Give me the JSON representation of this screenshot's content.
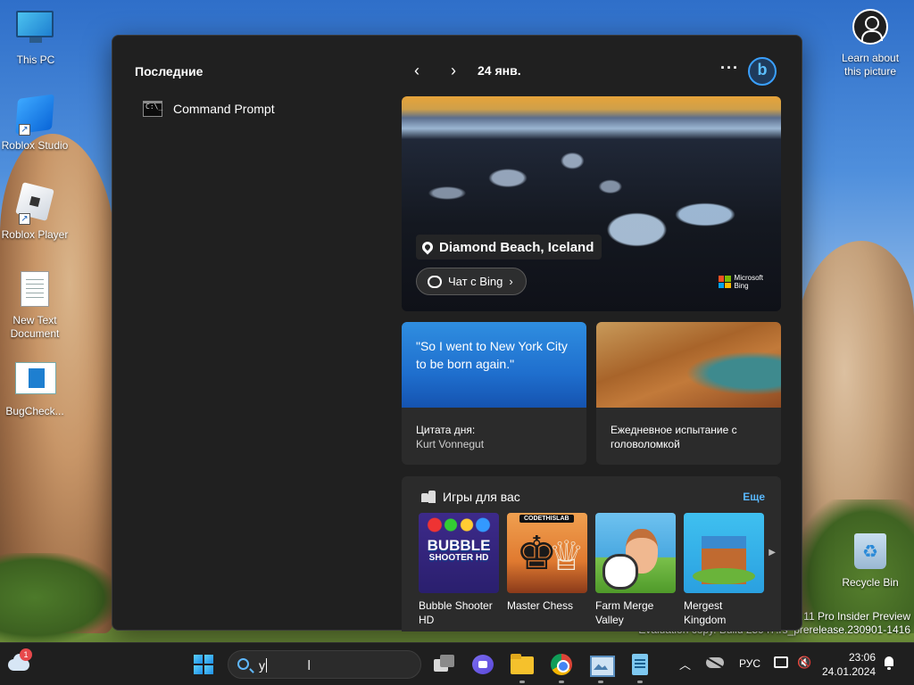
{
  "desktop": {
    "icons": [
      {
        "label": "This PC"
      },
      {
        "label": "Roblox Studio"
      },
      {
        "label": "Roblox Player"
      },
      {
        "label": "New Text Document"
      },
      {
        "label": "BugCheck..."
      },
      {
        "label": "Recycle Bin"
      },
      {
        "label": "Learn about this picture"
      }
    ],
    "watermark_line1": "s 11 Pro Insider Preview",
    "watermark_line2": "Evaluation copy. Build 25947.rs_prerelease.230901-1416"
  },
  "search_panel": {
    "recent_title": "Последние",
    "recent_items": [
      {
        "label": "Command Prompt",
        "icon": "command-prompt-icon"
      }
    ],
    "date": "24 янв.",
    "more_label": "···",
    "hero": {
      "location": "Diamond Beach, Iceland",
      "chat_button": "Чат с Bing",
      "brand_line1": "Microsoft",
      "brand_line2": "Bing"
    },
    "quote_card": {
      "quote": "\"So I went to New York City to be born again.\"",
      "title": "Цитата дня:",
      "author": "Kurt Vonnegut"
    },
    "puzzle_card": {
      "title": "Ежедневное испытание с головоломкой"
    },
    "games": {
      "title": "Игры для вас",
      "more": "Еще",
      "items": [
        {
          "name": "Bubble Shooter HD"
        },
        {
          "name": "Master Chess"
        },
        {
          "name": "Farm Merge Valley"
        },
        {
          "name": "Mergest Kingdom"
        }
      ],
      "bubble_logo_line1": "BUBBLE",
      "bubble_logo_line2": "SHOOTER HD",
      "chess_badge": "CODETHISLAB"
    }
  },
  "taskbar": {
    "weather_badge": "1",
    "search_value": "y",
    "apps": [
      "task-view",
      "meet",
      "file-explorer",
      "chrome",
      "photos",
      "notepad"
    ],
    "tray_lang": "РУС",
    "time": "23:06",
    "date": "24.01.2024"
  },
  "colors": {
    "panel_bg": "#202020",
    "card_bg": "#2b2b2b",
    "accent_link": "#59b8ff",
    "taskbar_bg": "#1f1f1f"
  }
}
